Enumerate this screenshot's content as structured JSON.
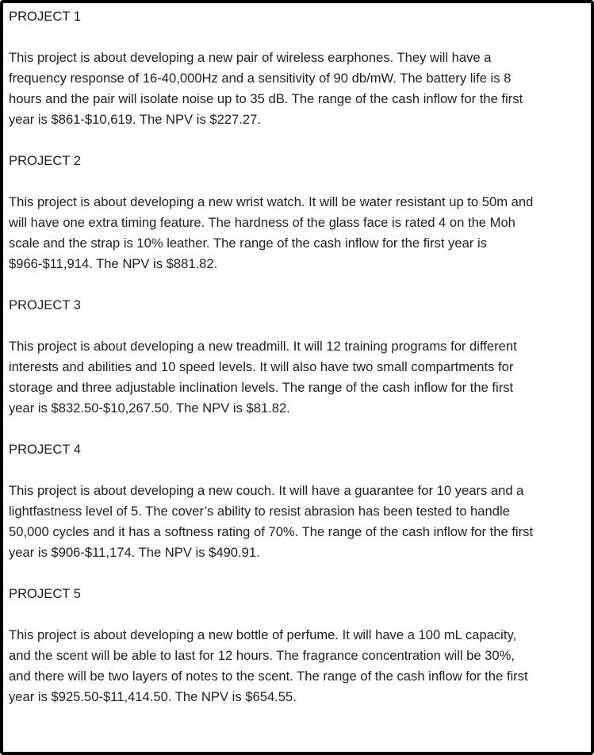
{
  "projects": [
    {
      "title": "PROJECT 1",
      "lines": [
        "This project is about developing a new pair of wireless earphones. They will have a",
        "frequency response of 16-40,000Hz and a sensitivity of 90 db/mW. The battery life is 8",
        "hours and the pair will isolate noise up to 35 dB. The range of the cash inflow for the first",
        "year is $861-$10,619. The NPV is $227.27."
      ]
    },
    {
      "title": "PROJECT 2",
      "lines": [
        "This project is about developing a new wrist watch. It will be water resistant up to 50m and",
        "will have one extra timing feature. The hardness of the glass face is rated 4 on the Moh",
        "scale and the strap is 10% leather. The range of the cash inflow for the first year is",
        "$966-$11,914. The NPV is $881.82."
      ]
    },
    {
      "title": "PROJECT 3",
      "lines": [
        "This project is about developing a new treadmill. It will 12 training programs for different",
        "interests and abilities and 10 speed levels. It will also have two small compartments for",
        "storage and three adjustable inclination levels. The range of the cash inflow for the first",
        "year is $832.50-$10,267.50. The NPV is $81.82."
      ]
    },
    {
      "title": "PROJECT 4",
      "lines": [
        "This project is about developing a new couch. It will have a guarantee for 10 years and a",
        "lightfastness level of 5. The cover’s ability to resist abrasion has been tested to handle",
        "50,000 cycles and it has a softness rating of 70%. The range of the cash inflow for the first",
        "year is $906-$11,174. The NPV is $490.91."
      ]
    },
    {
      "title": "PROJECT 5",
      "lines": [
        "This project is about developing a new bottle of perfume. It will have a 100 mL capacity,",
        "and the scent will be able to last for 12 hours. The fragrance concentration will be 30%,",
        "and there will be two layers of notes to the scent. The range of the cash inflow for the first",
        "year is $925.50-$11,414.50. The NPV is $654.55."
      ]
    }
  ]
}
